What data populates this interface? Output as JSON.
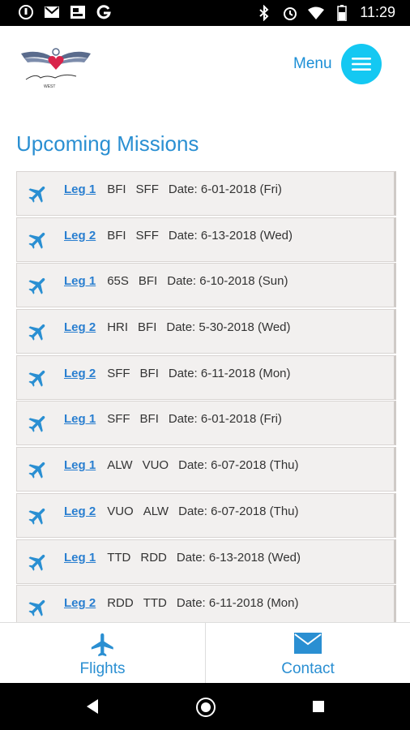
{
  "status_bar": {
    "time": "11:29",
    "left_icons": [
      "notification-icon",
      "gmail-icon",
      "photo-icon",
      "google-g-icon"
    ],
    "right_icons": [
      "bluetooth-icon",
      "alarm-icon",
      "wifi-icon",
      "battery-icon"
    ]
  },
  "header": {
    "logo_text": "Angel Flight",
    "logo_subtext": "WEST",
    "menu_label": "Menu"
  },
  "page": {
    "title": "Upcoming Missions"
  },
  "missions": [
    {
      "leg": "Leg 1",
      "from": "BFI",
      "to": "SFF",
      "date": "Date: 6-01-2018 (Fri)"
    },
    {
      "leg": "Leg 2",
      "from": "BFI",
      "to": "SFF",
      "date": "Date: 6-13-2018 (Wed)"
    },
    {
      "leg": "Leg 1",
      "from": "65S",
      "to": "BFI",
      "date": "Date: 6-10-2018 (Sun)"
    },
    {
      "leg": "Leg 2",
      "from": "HRI",
      "to": "BFI",
      "date": "Date: 5-30-2018 (Wed)"
    },
    {
      "leg": "Leg 2",
      "from": "SFF",
      "to": "BFI",
      "date": "Date: 6-11-2018 (Mon)"
    },
    {
      "leg": "Leg 1",
      "from": "SFF",
      "to": "BFI",
      "date": "Date: 6-01-2018 (Fri)"
    },
    {
      "leg": "Leg 1",
      "from": "ALW",
      "to": "VUO",
      "date": "Date: 6-07-2018 (Thu)"
    },
    {
      "leg": "Leg 2",
      "from": "VUO",
      "to": "ALW",
      "date": "Date: 6-07-2018 (Thu)"
    },
    {
      "leg": "Leg 1",
      "from": "TTD",
      "to": "RDD",
      "date": "Date: 6-13-2018 (Wed)"
    },
    {
      "leg": "Leg 2",
      "from": "RDD",
      "to": "TTD",
      "date": "Date: 6-11-2018 (Mon)"
    }
  ],
  "tabs": {
    "flights": "Flights",
    "contact": "Contact"
  },
  "colors": {
    "accent": "#2a8fd2",
    "menu_button": "#14c8f2",
    "row_bg": "#f2f0ef"
  }
}
